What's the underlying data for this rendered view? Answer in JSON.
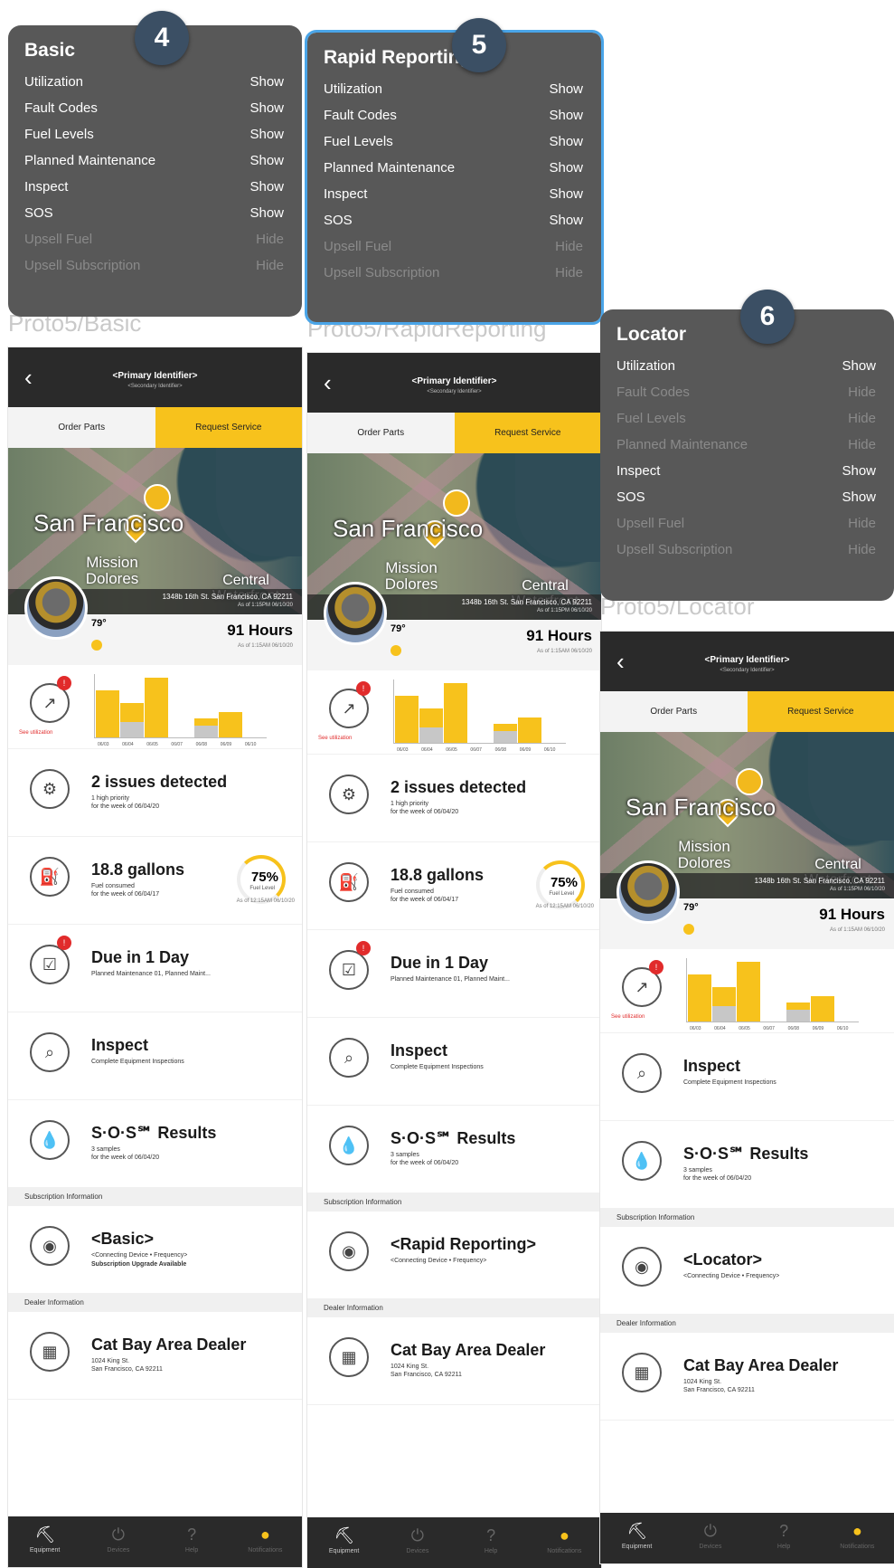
{
  "panels": [
    {
      "number": "4",
      "proto_label": "Proto5/Basic",
      "popup_title": "Basic",
      "features": [
        {
          "name": "Utilization",
          "state": "Show"
        },
        {
          "name": "Fault Codes",
          "state": "Show"
        },
        {
          "name": "Fuel Levels",
          "state": "Show"
        },
        {
          "name": "Planned Maintenance",
          "state": "Show"
        },
        {
          "name": "Inspect",
          "state": "Show"
        },
        {
          "name": "SOS",
          "state": "Show"
        },
        {
          "name": "Upsell Fuel",
          "state": "Hide"
        },
        {
          "name": "Upsell Subscription",
          "state": "Hide"
        }
      ],
      "subscription_name": "<Basic>",
      "subscription_line1": "<Connecting Device • Frequency>",
      "subscription_line2": "Subscription Upgrade Available"
    },
    {
      "number": "5",
      "proto_label": "Proto5/RapidReporting",
      "popup_title": "Rapid Reporting",
      "features": [
        {
          "name": "Utilization",
          "state": "Show"
        },
        {
          "name": "Fault Codes",
          "state": "Show"
        },
        {
          "name": "Fuel Levels",
          "state": "Show"
        },
        {
          "name": "Planned Maintenance",
          "state": "Show"
        },
        {
          "name": "Inspect",
          "state": "Show"
        },
        {
          "name": "SOS",
          "state": "Show"
        },
        {
          "name": "Upsell Fuel",
          "state": "Hide"
        },
        {
          "name": "Upsell Subscription",
          "state": "Hide"
        }
      ],
      "subscription_name": "<Rapid Reporting>",
      "subscription_line1": "<Connecting Device • Frequency>",
      "subscription_line2": ""
    },
    {
      "number": "6",
      "proto_label": "Proto5/Locator",
      "popup_title": "Locator",
      "features": [
        {
          "name": "Utilization",
          "state": "Show"
        },
        {
          "name": "Fault Codes",
          "state": "Hide"
        },
        {
          "name": "Fuel Levels",
          "state": "Hide"
        },
        {
          "name": "Planned Maintenance",
          "state": "Hide"
        },
        {
          "name": "Inspect",
          "state": "Show"
        },
        {
          "name": "SOS",
          "state": "Show"
        },
        {
          "name": "Upsell Fuel",
          "state": "Hide"
        },
        {
          "name": "Upsell Subscription",
          "state": "Hide"
        }
      ],
      "subscription_name": "<Locator>",
      "subscription_line1": "<Connecting Device • Frequency>",
      "subscription_line2": ""
    }
  ],
  "app": {
    "primary_identifier": "<Primary Identifier>",
    "secondary_identifier": "<Secondary Identifier>",
    "order_parts": "Order Parts",
    "request_service": "Request Service",
    "map_city": "San Francisco",
    "map_neighborhood1": "Mission Dolores",
    "map_neighborhood2": "Central Waterfront",
    "address": "1348b 16th St.  San Francisco, CA 92211",
    "address_asof": "As of 1:15PM 06/10/20",
    "temperature": "79°",
    "hours": "91 Hours",
    "hours_asof": "As of 1:15AM 06/10/20",
    "utilization_label": "See utilization",
    "util_dates": [
      "06/03",
      "06/04",
      "06/05",
      "06/07",
      "06/08",
      "06/09",
      "06/10"
    ],
    "issues_title": "2 issues detected",
    "issues_line1": "1 high priority",
    "issues_line2": "for the week of 06/04/20",
    "fuel_title": "18.8 gallons",
    "fuel_line1": "Fuel consumed",
    "fuel_line2": "for the week of 06/04/17",
    "fuel_pct": "75%",
    "fuel_level_label": "Fuel Level",
    "fuel_asof": "As of 12:15AM 06/10/20",
    "pm_title": "Due in 1 Day",
    "pm_line1": "Planned Maintenance 01, Planned Maint...",
    "inspect_title": "Inspect",
    "inspect_line1": "Complete Equipment Inspections",
    "sos_title": "S·O·S℠ Results",
    "sos_line1": "3 samples",
    "sos_line2": "for the week of 06/04/20",
    "subscription_section": "Subscription Information",
    "dealer_section": "Dealer Information",
    "dealer_name": "Cat Bay Area Dealer",
    "dealer_line1": "1024 King St.",
    "dealer_line2": "San Francisco, CA 92211",
    "nav": [
      "Equipment",
      "Devices",
      "Help",
      "Notifications"
    ]
  },
  "util_chart": {
    "type": "bar",
    "categories": [
      "06/03",
      "06/04",
      "06/05",
      "06/07",
      "06/08",
      "06/09",
      "06/10"
    ],
    "series": [
      {
        "values": [
          0.75,
          0.55,
          0.95,
          0.0,
          0.3,
          0.4,
          0.0
        ]
      },
      {
        "values": [
          0.0,
          0.25,
          0.0,
          0.0,
          0.18,
          0.0,
          0.0
        ]
      }
    ]
  },
  "colors": {
    "accent": "#f7c21c",
    "dark": "#2a2a2a",
    "popup": "#585858",
    "badge": "#3b4f64",
    "alert": "#e12b2b"
  }
}
